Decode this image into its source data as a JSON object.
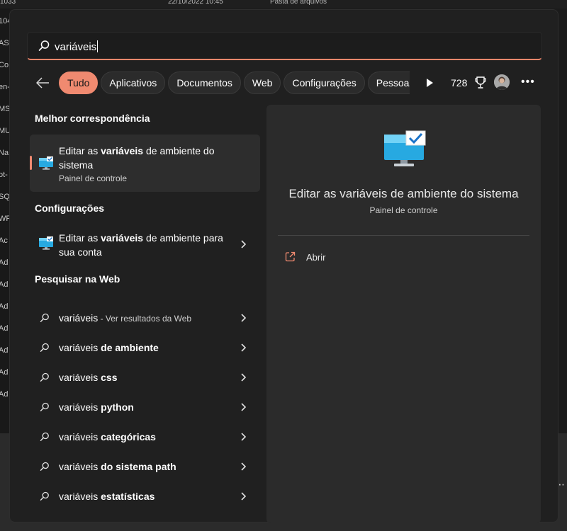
{
  "background": {
    "top_date": "22/10/2022 10:45",
    "top_type": "Pasta de arquivos",
    "top_left": "1033",
    "left_fragments": [
      "104",
      "ASI",
      "Co",
      "en-",
      "MS",
      "MU",
      "Na",
      "ot-",
      "SQ",
      "WF",
      "Ac",
      "Ad",
      "Ad",
      "Ad",
      "Ad",
      "Ad",
      "Ad",
      "Ad"
    ],
    "right_dots": "⋯"
  },
  "search": {
    "value": "variáveis"
  },
  "filters": {
    "tabs": [
      "Tudo",
      "Aplicativos",
      "Documentos",
      "Web",
      "Configurações",
      "Pessoas"
    ],
    "active_index": 0,
    "points": "728"
  },
  "sections": {
    "best_match_title": "Melhor correspondência",
    "settings_title": "Configurações",
    "web_title": "Pesquisar na Web"
  },
  "best_match": {
    "title_prefix": "Editar as ",
    "title_bold": "variáveis",
    "title_suffix": " de ambiente do sistema",
    "subtitle": "Painel de controle"
  },
  "settings_item": {
    "title_prefix": "Editar as ",
    "title_bold": "variáveis",
    "title_suffix": " de ambiente para sua conta"
  },
  "web_results": [
    {
      "query": "variáveis",
      "bold": "",
      "hint": " - Ver resultados da Web"
    },
    {
      "query": "variáveis ",
      "bold": "de ambiente",
      "hint": ""
    },
    {
      "query": "variáveis ",
      "bold": "css",
      "hint": ""
    },
    {
      "query": "variáveis ",
      "bold": "python",
      "hint": ""
    },
    {
      "query": "variáveis ",
      "bold": "categóricas",
      "hint": ""
    },
    {
      "query": "variáveis ",
      "bold": "do sistema path",
      "hint": ""
    },
    {
      "query": "variáveis ",
      "bold": "estatísticas",
      "hint": ""
    }
  ],
  "preview": {
    "title": "Editar as variáveis de ambiente do sistema",
    "subtitle": "Painel de controle",
    "open_label": "Abrir"
  },
  "colors": {
    "accent": "#f08a70",
    "panel": "#202020",
    "preview": "#2b2b2b"
  }
}
